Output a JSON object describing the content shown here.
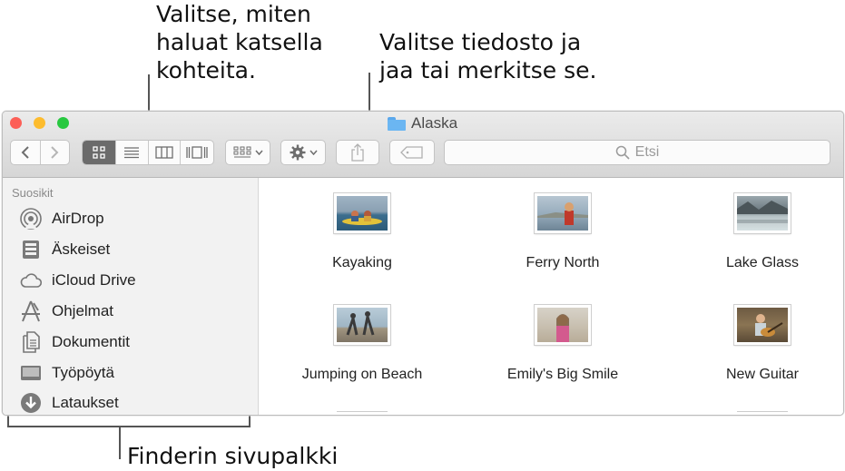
{
  "callouts": {
    "view_text": "Valitse, miten\nhaluat katsella\nkohteita.",
    "file_text": "Valitse tiedosto ja\njaa tai merkitse se.",
    "sidebar_text": "Finderin sivupalkki"
  },
  "window": {
    "title": "Alaska",
    "search_placeholder": "Etsi"
  },
  "sidebar": {
    "header": "Suosikit",
    "items": [
      {
        "label": "AirDrop",
        "icon": "airdrop-icon"
      },
      {
        "label": "Äskeiset",
        "icon": "recents-icon"
      },
      {
        "label": "iCloud Drive",
        "icon": "cloud-icon"
      },
      {
        "label": "Ohjelmat",
        "icon": "applications-icon"
      },
      {
        "label": "Dokumentit",
        "icon": "documents-icon"
      },
      {
        "label": "Työpöytä",
        "icon": "desktop-icon"
      },
      {
        "label": "Lataukset",
        "icon": "downloads-icon"
      }
    ]
  },
  "files": [
    {
      "label": "Kayaking"
    },
    {
      "label": "Ferry North"
    },
    {
      "label": "Lake Glass"
    },
    {
      "label": "Jumping on Beach"
    },
    {
      "label": "Emily's Big Smile"
    },
    {
      "label": "New Guitar"
    }
  ],
  "colors": {
    "close": "#fc5f57",
    "minimize": "#fdbc2e",
    "zoom": "#28c840",
    "folder": "#6bb6f2"
  }
}
